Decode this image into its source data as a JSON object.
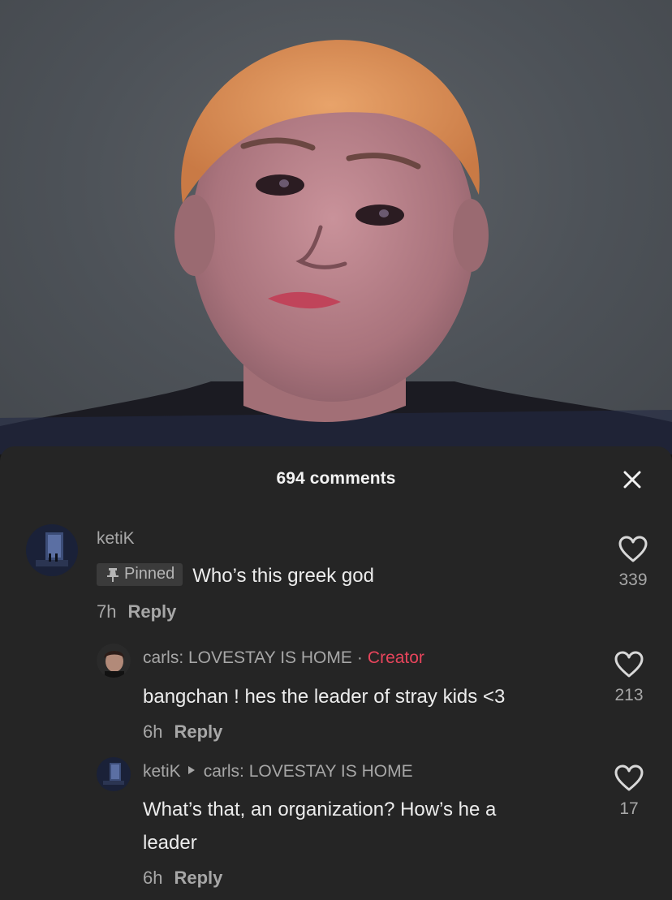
{
  "sheet": {
    "title": "694 comments"
  },
  "comments": [
    {
      "username": "ketiK",
      "pinned_label": "Pinned",
      "text": "Who’s this greek god",
      "time": "7h",
      "reply_label": "Reply",
      "likes": "339"
    },
    {
      "username": "carls: LOVESTAY IS HOME",
      "separator": "·",
      "creator_label": "Creator",
      "text": "bangchan ! hes the leader of stray kids <3",
      "time": "6h",
      "reply_label": "Reply",
      "likes": "213"
    },
    {
      "username": "ketiK",
      "reply_to": "carls: LOVESTAY IS HOME",
      "text_line1": "What’s that, an organization? How’s he a",
      "text_line2": "leader",
      "time": "6h",
      "reply_label": "Reply",
      "likes": "17"
    }
  ],
  "colors": {
    "sheet_bg": "#252525",
    "creator_accent": "#e8455c",
    "secondary_text": "#a7a7a7",
    "primary_text": "#ececec"
  },
  "icons": {
    "close": "close-icon",
    "like": "heart-outline-icon",
    "pin": "pin-icon",
    "reply_arrow": "caret-right-icon"
  }
}
